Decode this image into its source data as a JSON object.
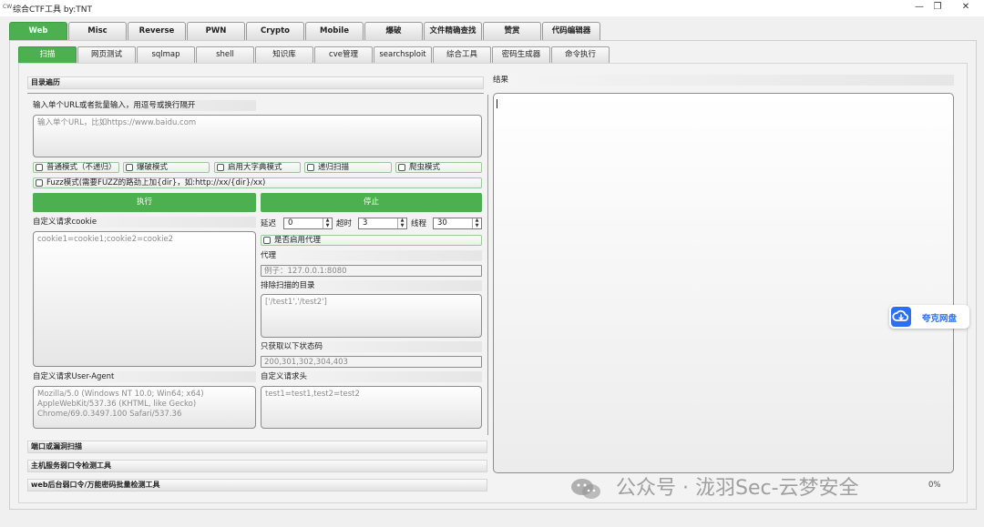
{
  "window": {
    "app_icon": "CW",
    "title": "综合CTF工具   by:TNT",
    "minimize": "—",
    "restore": "❐",
    "close": "✕"
  },
  "main_tabs": [
    {
      "label": "Web",
      "active": true
    },
    {
      "label": "Misc"
    },
    {
      "label": "Reverse"
    },
    {
      "label": "PWN"
    },
    {
      "label": "Crypto"
    },
    {
      "label": "Mobile"
    },
    {
      "label": "爆破"
    },
    {
      "label": "文件精确查找"
    },
    {
      "label": "赞赏"
    },
    {
      "label": "代码编辑器"
    }
  ],
  "sub_tabs": [
    {
      "label": "扫描",
      "active": true
    },
    {
      "label": "网页测试"
    },
    {
      "label": "sqlmap"
    },
    {
      "label": "shell"
    },
    {
      "label": "知识库"
    },
    {
      "label": "cve管理"
    },
    {
      "label": "searchsploit"
    },
    {
      "label": "综合工具"
    },
    {
      "label": "密码生成器"
    },
    {
      "label": "命令执行"
    }
  ],
  "scan": {
    "section_title": "目录遍历",
    "url_label": "输入单个URL或者批量输入，用逗号或换行隔开",
    "url_placeholder": "输入单个URL，比如https://www.baidu.com",
    "modes": [
      "普通模式（不递归）",
      "爆破模式",
      "启用大字典模式",
      "递归扫描",
      "爬虫模式"
    ],
    "fuzz_mode": "Fuzz模式(需要FUZZ的路劲上加{dir}，如:http://xx/{dir}/xx)",
    "execute_button": "执行",
    "stop_button": "停止",
    "cookie_label": "自定义请求cookie",
    "cookie_placeholder": "cookie1=cookie1;cookie2=cookie2",
    "delay_label": "延迟",
    "delay_value": "0",
    "timeout_label": "超时",
    "timeout_value": "3",
    "threads_label": "线程",
    "threads_value": "30",
    "proxy_toggle": "是否启用代理",
    "proxy_label": "代理",
    "proxy_placeholder": "例子：127.0.0.1:8080",
    "exclude_label": "排除扫描的目录",
    "exclude_placeholder": "['/test1','/test2']",
    "status_label": "只获取以下状态码",
    "status_placeholder": "200,301,302,304,403",
    "ua_label": "自定义请求User-Agent",
    "ua_placeholder": "Mozilla/5.0 (Windows NT 10.0; Win64; x64) AppleWebKit/537.36 (KHTML, like Gecko) Chrome/69.0.3497.100 Safari/537.36",
    "headers_label": "自定义请求头",
    "headers_placeholder": "test1=test1,test2=test2"
  },
  "sections": [
    "端口或漏洞扫描",
    "主机服务弱口令检测工具",
    "web后台弱口令/万能密码批量检测工具"
  ],
  "result": {
    "label": "结果",
    "progress": "0%"
  },
  "overlay": {
    "quark_label": "夸克网盘",
    "watermark": "公众号 · 泷羽Sec-云梦安全"
  },
  "colors": {
    "accent": "#4caf50",
    "quark_blue": "#2d6ff2"
  }
}
